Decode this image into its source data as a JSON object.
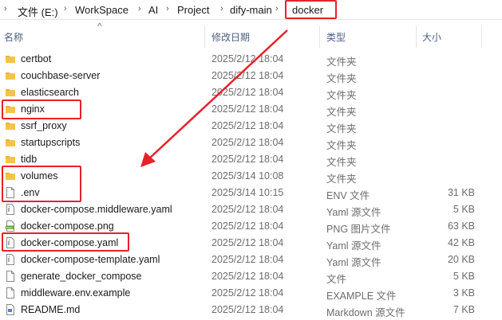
{
  "breadcrumb": {
    "items": [
      "文件 (E:)",
      "WorkSpace",
      "AI",
      "Project",
      "dify-main",
      "docker"
    ]
  },
  "columns": {
    "name": "名称",
    "modified": "修改日期",
    "type": "类型",
    "size": "大小"
  },
  "files": [
    {
      "name": "certbot",
      "modified": "2025/2/12 18:04",
      "type": "文件夹",
      "size": "",
      "icon": "folder-icon"
    },
    {
      "name": "couchbase-server",
      "modified": "2025/2/12 18:04",
      "type": "文件夹",
      "size": "",
      "icon": "folder-icon"
    },
    {
      "name": "elasticsearch",
      "modified": "2025/2/12 18:04",
      "type": "文件夹",
      "size": "",
      "icon": "folder-icon"
    },
    {
      "name": "nginx",
      "modified": "2025/2/12 18:04",
      "type": "文件夹",
      "size": "",
      "icon": "folder-icon"
    },
    {
      "name": "ssrf_proxy",
      "modified": "2025/2/12 18:04",
      "type": "文件夹",
      "size": "",
      "icon": "folder-icon"
    },
    {
      "name": "startupscripts",
      "modified": "2025/2/12 18:04",
      "type": "文件夹",
      "size": "",
      "icon": "folder-icon"
    },
    {
      "name": "tidb",
      "modified": "2025/2/12 18:04",
      "type": "文件夹",
      "size": "",
      "icon": "folder-icon"
    },
    {
      "name": "volumes",
      "modified": "2025/3/14 10:08",
      "type": "文件夹",
      "size": "",
      "icon": "folder-icon"
    },
    {
      "name": ".env",
      "modified": "2025/3/14 10:15",
      "type": "ENV 文件",
      "size": "31 KB",
      "icon": "file-icon"
    },
    {
      "name": "docker-compose.middleware.yaml",
      "modified": "2025/2/12 18:04",
      "type": "Yaml 源文件",
      "size": "5 KB",
      "icon": "yaml-file-icon"
    },
    {
      "name": "docker-compose.png",
      "modified": "2025/2/12 18:04",
      "type": "PNG 图片文件",
      "size": "63 KB",
      "icon": "png-image-icon"
    },
    {
      "name": "docker-compose.yaml",
      "modified": "2025/2/12 18:04",
      "type": "Yaml 源文件",
      "size": "42 KB",
      "icon": "yaml-file-icon"
    },
    {
      "name": "docker-compose-template.yaml",
      "modified": "2025/2/12 18:04",
      "type": "Yaml 源文件",
      "size": "20 KB",
      "icon": "yaml-file-icon"
    },
    {
      "name": "generate_docker_compose",
      "modified": "2025/2/12 18:04",
      "type": "文件",
      "size": "5 KB",
      "icon": "file-icon"
    },
    {
      "name": "middleware.env.example",
      "modified": "2025/2/12 18:04",
      "type": "EXAMPLE 文件",
      "size": "3 KB",
      "icon": "file-icon"
    },
    {
      "name": "README.md",
      "modified": "2025/2/12 18:04",
      "type": "Markdown 源文件",
      "size": "7 KB",
      "icon": "markdown-file-icon"
    }
  ],
  "colors": {
    "annotation_red": "#e8212a",
    "folder_yellow": "#f6c344",
    "header_text": "#4d6082"
  }
}
